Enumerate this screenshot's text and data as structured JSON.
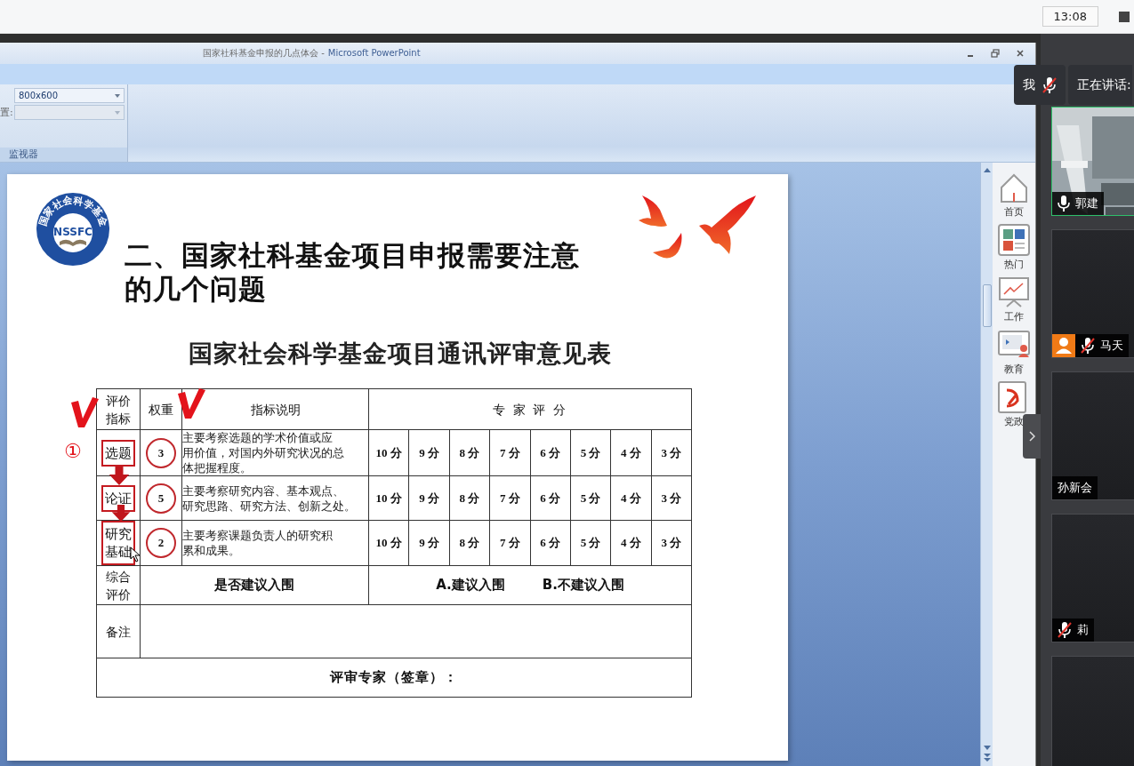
{
  "top_bar": {
    "clock": "13:08"
  },
  "window": {
    "title": "国家社科基金申报的几点体会 -",
    "app": "Microsoft PowerPoint"
  },
  "ribbon": {
    "field_label": "置:",
    "resolution": "800x600",
    "group_label": "监视器"
  },
  "slide": {
    "logo_ring": "国家社会科学基金",
    "logo_text": "NSSFC",
    "heading_lines": [
      "二、国家社科基金项目申报需要注意",
      "的几个问题"
    ],
    "form_title": "国家社会科学基金项目通讯评审意见表",
    "table": {
      "header": {
        "indicator": [
          "评价",
          "指标"
        ],
        "weight": "权重",
        "description": "指标说明",
        "scoring": "专 家 评 分"
      },
      "rows": [
        {
          "indicator": [
            "选题"
          ],
          "boxed": true,
          "weight": "3",
          "circled": true,
          "description": [
            "主要考察选题的学术价值或应",
            "用价值，对国内外研究状况的总",
            "体把握程度。"
          ],
          "scores": [
            "10 分",
            "9 分",
            "8 分",
            "7 分",
            "6 分",
            "5 分",
            "4 分",
            "3 分"
          ]
        },
        {
          "indicator": [
            "论证"
          ],
          "boxed": true,
          "weight": "5",
          "circled": true,
          "description": [
            "主要考察研究内容、基本观点、",
            "研究思路、研究方法、创新之处。"
          ],
          "scores": [
            "10 分",
            "9 分",
            "8 分",
            "7 分",
            "6 分",
            "5 分",
            "4 分",
            "3 分"
          ]
        },
        {
          "indicator": [
            "研究",
            "基础"
          ],
          "boxed": true,
          "weight": "2",
          "circled": true,
          "description": [
            "主要考察课题负责人的研究积",
            "累和成果。"
          ],
          "scores": [
            "10 分",
            "9 分",
            "8 分",
            "7 分",
            "6 分",
            "5 分",
            "4 分",
            "3 分"
          ]
        }
      ],
      "overall": {
        "label": [
          "综合",
          "评价"
        ],
        "question": "是否建议入围",
        "options": [
          "A.建议入围",
          "B.不建议入围"
        ]
      },
      "remarks": {
        "label": "备注"
      },
      "signature": "评审专家（签章）："
    },
    "annotations": {
      "number": "①"
    }
  },
  "sidebar": {
    "items": [
      {
        "kind": "home",
        "label": "首页"
      },
      {
        "kind": "tiles",
        "label": "热门"
      },
      {
        "kind": "chart",
        "label": "工作"
      },
      {
        "kind": "lesson",
        "label": "教育"
      },
      {
        "kind": "emblem",
        "label": "党政"
      }
    ]
  },
  "video": {
    "self": {
      "label": "我",
      "muted": true
    },
    "speaking": "正在讲话:",
    "tiles": [
      {
        "kind": "camera",
        "name": "郭建",
        "muted": false,
        "avatar": false,
        "active": true
      },
      {
        "kind": "blank",
        "name": "马天",
        "muted": true,
        "avatar": true,
        "active": false
      },
      {
        "kind": "blank",
        "name": "孙新会",
        "avatar": false,
        "active": false
      },
      {
        "kind": "blank",
        "name": "莉",
        "muted": true,
        "avatar": false,
        "active": false
      },
      {
        "kind": "blank",
        "avatar": false,
        "active": false
      }
    ]
  }
}
